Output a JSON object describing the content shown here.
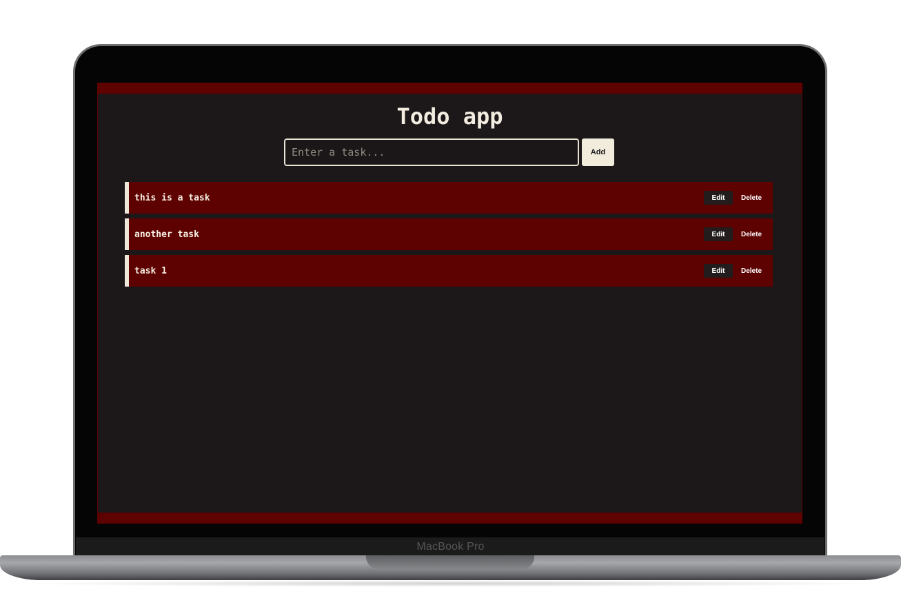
{
  "device": {
    "brand_label": "MacBook Pro"
  },
  "app": {
    "title": "Todo app",
    "input": {
      "placeholder": "Enter a task...",
      "value": ""
    },
    "add_label": "Add",
    "tasks": [
      {
        "text": "this is a task",
        "edit_label": "Edit",
        "delete_label": "Delete"
      },
      {
        "text": "another task",
        "edit_label": "Edit",
        "delete_label": "Delete"
      },
      {
        "text": "task 1",
        "edit_label": "Edit",
        "delete_label": "Delete"
      }
    ]
  },
  "colors": {
    "accent_bar": "#5e0101",
    "background": "#1c1718",
    "text": "#f3ece0",
    "add_button_bg": "#f2ecdd",
    "edit_button_bg": "#231c1d"
  }
}
